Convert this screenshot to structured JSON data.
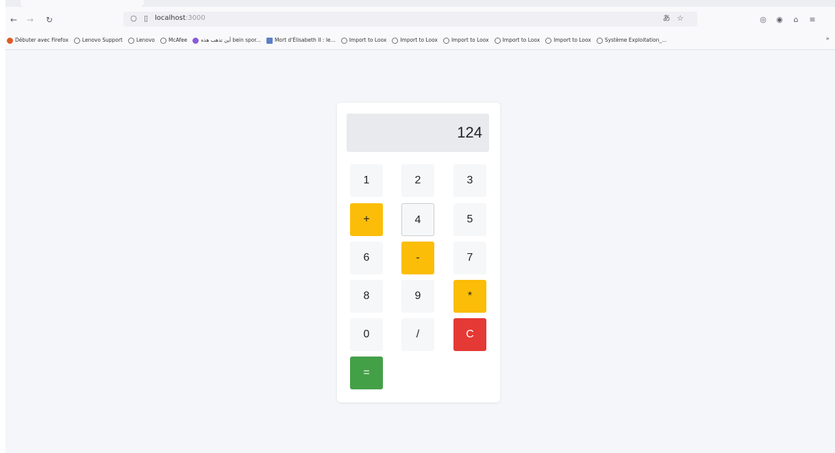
{
  "browser": {
    "url_host": "localhost",
    "url_port": ":3000",
    "bookmarks": [
      {
        "label": "Débuter avec Firefox",
        "icon": "firefox-icon"
      },
      {
        "label": "Lenovo Support",
        "icon": "globe-icon"
      },
      {
        "label": "Lenovo",
        "icon": "globe-icon"
      },
      {
        "label": "McAfee",
        "icon": "globe-icon"
      },
      {
        "label": "أين تذهب هذه bein spor...",
        "icon": "purple-icon"
      },
      {
        "label": "Mort d'Élisabeth II : le...",
        "icon": "doc-icon"
      },
      {
        "label": "Import to Loox",
        "icon": "globe-icon"
      },
      {
        "label": "Import to Loox",
        "icon": "globe-icon"
      },
      {
        "label": "Import to Loox",
        "icon": "globe-icon"
      },
      {
        "label": "Import to Loox",
        "icon": "globe-icon"
      },
      {
        "label": "Import to Loox",
        "icon": "globe-icon"
      },
      {
        "label": "Système Exploitation_...",
        "icon": "globe-icon"
      }
    ],
    "bookmarks_more": "»"
  },
  "calculator": {
    "display": "124",
    "keys": {
      "k1": "1",
      "k2": "2",
      "k3": "3",
      "plus": "+",
      "k4": "4",
      "k5": "5",
      "k6": "6",
      "minus": "-",
      "k7": "7",
      "k8": "8",
      "k9": "9",
      "times": "*",
      "k0": "0",
      "divide": "/",
      "clear": "C",
      "equals": "="
    }
  },
  "colors": {
    "operator": "#fbbd08",
    "clear": "#e53935",
    "equals": "#43a047",
    "background": "#f4f6f9"
  }
}
